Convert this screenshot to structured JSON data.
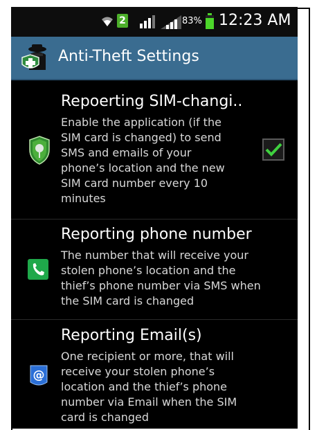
{
  "status_bar": {
    "sim_slot": "2",
    "battery_percent": "83%",
    "time": "12:23 AM"
  },
  "action_bar": {
    "title": "Anti-Theft Settings",
    "icon": "spy-shield-icon"
  },
  "settings": [
    {
      "title": "Repoerting SIM-changi..",
      "summary_lines": [
        "Enable the application (if the",
        "SIM card is changed) to send",
        "SMS and emails of your",
        "phone’s location and the new",
        "SIM card number every 10",
        "minutes"
      ],
      "icon": "shield-icon",
      "checked": true
    },
    {
      "title": "Reporting phone number",
      "summary_lines": [
        "The number that will receive your",
        "stolen phone’s location and the",
        "thief’s phone number via SMS when",
        "the SIM card is changed"
      ],
      "icon": "phone-icon"
    },
    {
      "title": "Reporting Email(s)",
      "summary_lines": [
        "One recipient or more, that will",
        "receive your stolen phone’s",
        "location and the thief’s phone",
        "number via Email when the SIM",
        "card is changed"
      ],
      "icon": "email-icon"
    }
  ]
}
